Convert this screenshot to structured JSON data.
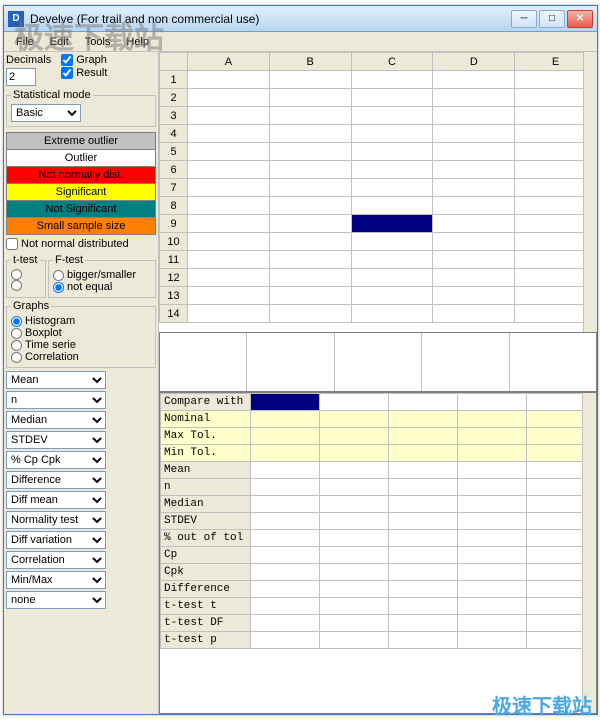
{
  "window": {
    "title": "Develve (For trail and non commercial use)",
    "icon_letter": "D"
  },
  "menu": [
    "File",
    "Edit",
    "Tools",
    "Help"
  ],
  "decimals": {
    "label": "Decimals",
    "value": "2"
  },
  "checks": {
    "graph": "Graph",
    "result": "Result"
  },
  "stat_mode": {
    "label": "Statistical mode",
    "value": "Basic"
  },
  "legend": {
    "extreme": "Extreme outlier",
    "outlier": "Outlier",
    "notnorm": "Not normally dist.",
    "sig": "Significant",
    "notsig": "Not Significant",
    "small": "Small sample size"
  },
  "notnormal_chk": "Not normal distributed",
  "ttest": {
    "label": "t-test"
  },
  "ftest": {
    "label": "F-test",
    "opt1": "bigger/smaller",
    "opt2": "not equal"
  },
  "graphs": {
    "label": "Graphs",
    "hist": "Histogram",
    "box": "Boxplot",
    "time": "Time serie",
    "corr": "Correlation"
  },
  "selects": [
    "Mean",
    "n",
    "Median",
    "STDEV",
    "% Cp Cpk",
    "Difference",
    "Diff mean",
    "Normality test",
    "Diff variation",
    "Correlation",
    "Min/Max",
    "none"
  ],
  "cols": [
    "A",
    "B",
    "C",
    "D",
    "E"
  ],
  "rows": [
    "1",
    "2",
    "3",
    "4",
    "5",
    "6",
    "7",
    "8",
    "9",
    "10",
    "11",
    "12",
    "13",
    "14"
  ],
  "selected_cell": {
    "row": 9,
    "col": "C"
  },
  "stat_rows": [
    "Compare with",
    "Nominal",
    "Max Tol.",
    "Min Tol.",
    "Mean",
    "n",
    "Median",
    "STDEV",
    "% out of tol",
    "Cp",
    "Cpk",
    "Difference",
    "t-test t",
    "t-test DF",
    "t-test p"
  ],
  "stat_yellow": [
    1,
    2,
    3
  ],
  "watermark": "极速下载站"
}
